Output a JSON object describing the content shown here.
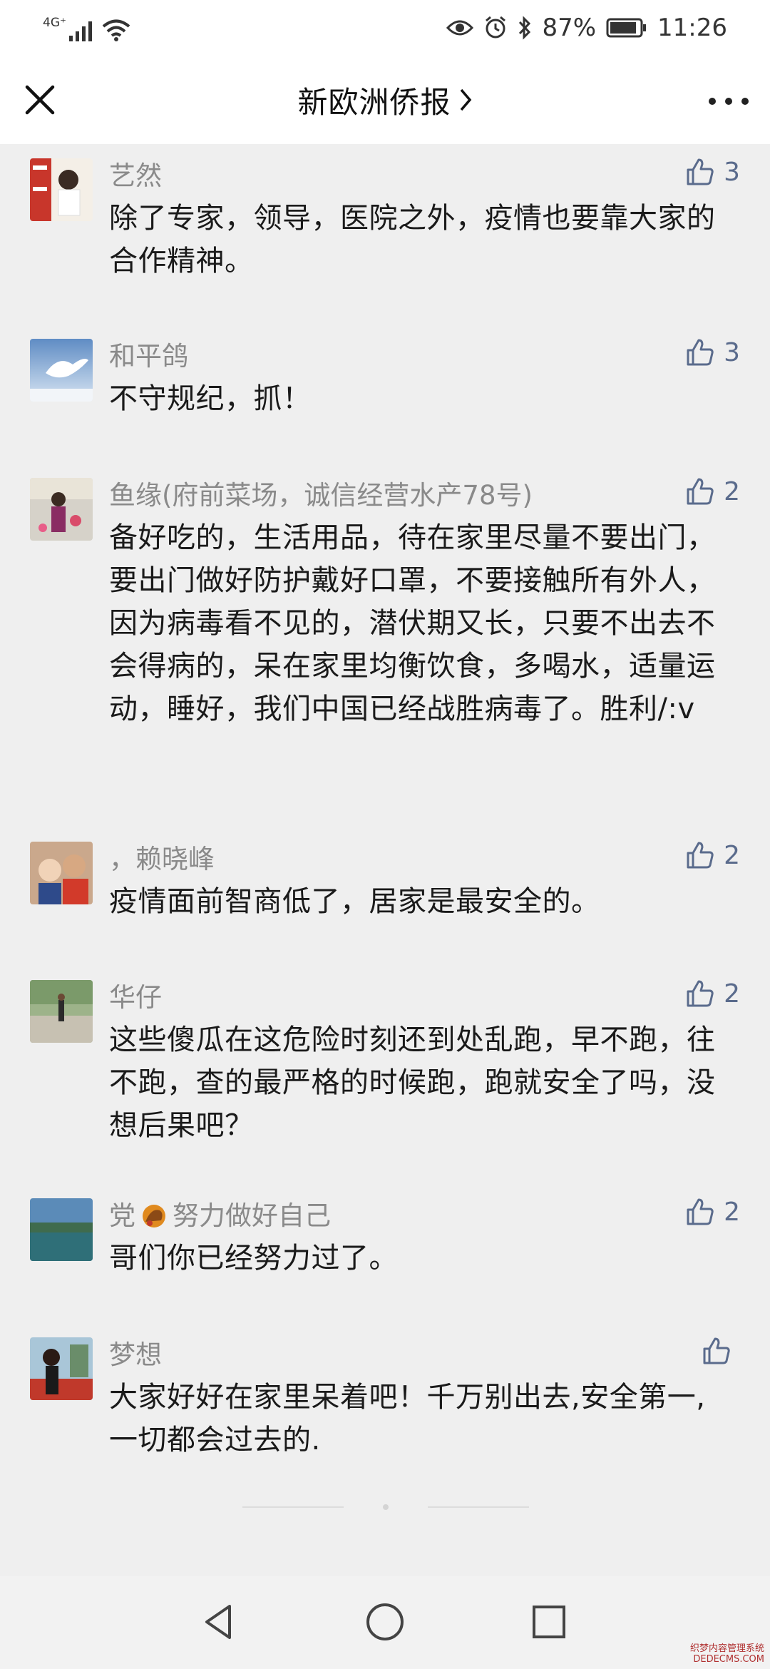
{
  "status_bar": {
    "network": "4G⁺",
    "battery": "87%",
    "time": "11:26"
  },
  "header": {
    "title": "新欧洲侨报",
    "chevron": "chevron-right-icon",
    "close_icon": "close-icon",
    "more_icon": "more-icon"
  },
  "comments": [
    {
      "nickname": "艺然",
      "text": "除了专家，领导，医院之外，疫情也要靠大家的合作精神。",
      "likes": "3"
    },
    {
      "nickname": "和平鸽",
      "text": "不守规纪，抓！",
      "likes": "3"
    },
    {
      "nickname": "鱼缘(府前菜场，诚信经营水产78号)",
      "text": "备好吃的，生活用品，待在家里尽量不要出门，要出门做好防护戴好口罩，不要接触所有外人，因为病毒看不见的，潜伏期又长，只要不出去不会得病的，呆在家里均衡饮食，多喝水，适量运动，睡好，我们中国已经战胜病毒了。胜利/:v",
      "likes": "2"
    },
    {
      "nickname": "，赖晓峰",
      "text": "疫情面前智商低了，居家是最安全的。",
      "likes": "2"
    },
    {
      "nickname": "华仔",
      "text": "这些傻瓜在这危险时刻还到处乱跑，早不跑，往不跑，查的最严格的时候跑，跑就安全了吗，没想后果吧？",
      "likes": "2"
    },
    {
      "nickname_prefix": "党",
      "nickname_suffix": "努力做好自己",
      "text": "哥们你已经努力过了。",
      "likes": "2"
    },
    {
      "nickname": "梦想",
      "text": "大家好好在家里呆着吧！千万别出去,安全第一,一切都会过去的.",
      "likes": ""
    }
  ],
  "watermark": {
    "line1": "织梦内容管理系统",
    "line2": "DEDECMS.COM"
  },
  "colors": {
    "background": "#efefef",
    "nickname": "#8a8a8a",
    "like_icon": "#5a6b8c"
  }
}
